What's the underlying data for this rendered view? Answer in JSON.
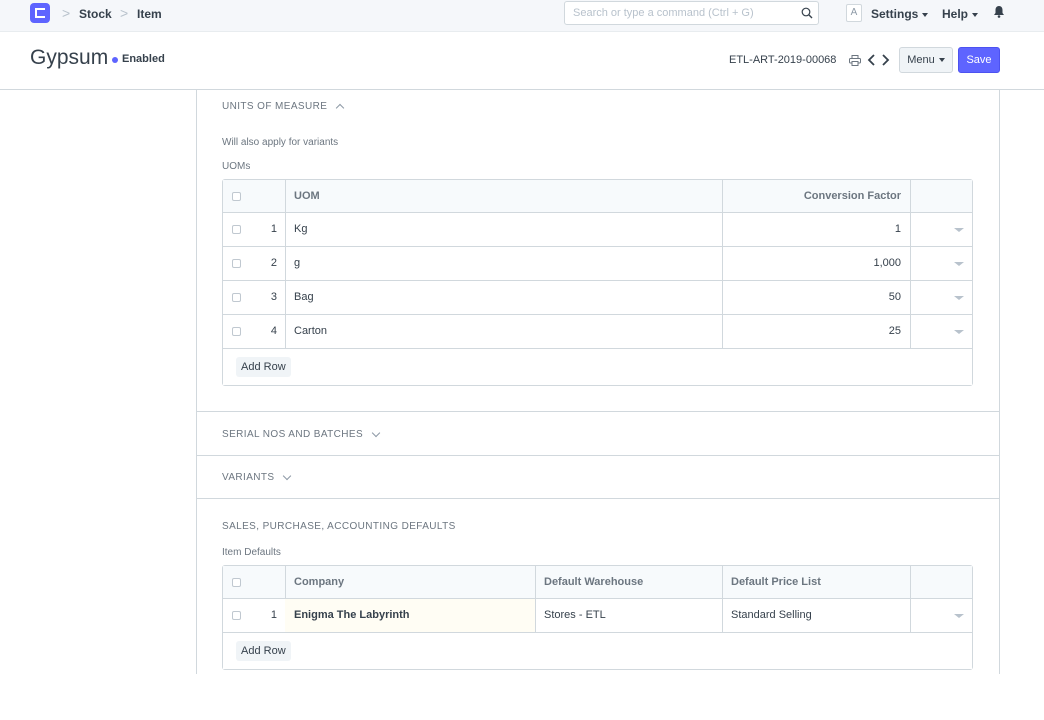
{
  "navbar": {
    "breadcrumbs": [
      "Stock",
      "Item"
    ],
    "search_placeholder": "Search or type a command (Ctrl + G)",
    "avatar_letter": "A",
    "settings_label": "Settings",
    "help_label": "Help"
  },
  "page": {
    "title": "Gypsum",
    "status": "Enabled",
    "doc_name": "ETL-ART-2019-00068",
    "menu_label": "Menu",
    "save_label": "Save",
    "accent_color": "#5e64ff"
  },
  "uom_section": {
    "heading": "UNITS OF MEASURE",
    "help": "Will also apply for variants",
    "table_label": "UOMs",
    "columns": [
      "UOM",
      "Conversion Factor"
    ],
    "rows": [
      {
        "idx": "1",
        "uom": "Kg",
        "factor": "1"
      },
      {
        "idx": "2",
        "uom": "g",
        "factor": "1,000"
      },
      {
        "idx": "3",
        "uom": "Bag",
        "factor": "50"
      },
      {
        "idx": "4",
        "uom": "Carton",
        "factor": "25"
      }
    ],
    "add_row": "Add Row"
  },
  "serial_section": {
    "heading": "SERIAL NOS AND BATCHES"
  },
  "variants_section": {
    "heading": "VARIANTS"
  },
  "defaults_section": {
    "heading": "SALES, PURCHASE, ACCOUNTING DEFAULTS",
    "table_label": "Item Defaults",
    "columns": [
      "Company",
      "Default Warehouse",
      "Default Price List"
    ],
    "rows": [
      {
        "idx": "1",
        "company": "Enigma The Labyrinth",
        "warehouse": "Stores - ETL",
        "price_list": "Standard Selling"
      }
    ],
    "add_row": "Add Row"
  }
}
